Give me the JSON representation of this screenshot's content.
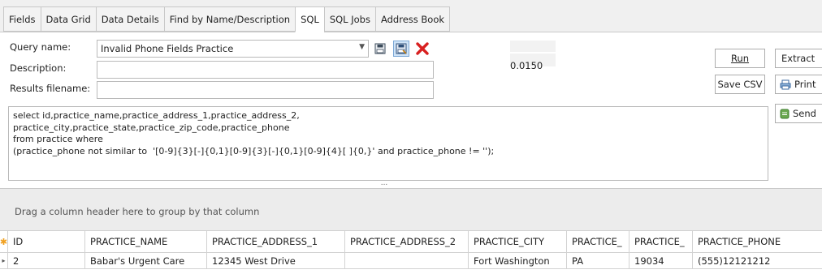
{
  "tabs": [
    "Fields",
    "Data Grid",
    "Data Details",
    "Find by Name/Description",
    "SQL",
    "SQL Jobs",
    "Address Book"
  ],
  "active_tab": "SQL",
  "form": {
    "query_name_label": "Query name:",
    "query_name_value": "Invalid Phone Fields Practice",
    "description_label": "Description:",
    "description_value": "",
    "results_filename_label": "Results filename:",
    "results_filename_value": "",
    "timing": "0.0150"
  },
  "buttons": {
    "run": "Run",
    "extract": "Extract",
    "save_csv": "Save CSV",
    "print": "Print",
    "send": "Send"
  },
  "sql_lines": [
    "select id,practice_name,practice_address_1,practice_address_2,",
    "practice_city,practice_state,practice_zip_code,practice_phone",
    "from practice where",
    "(practice_phone not similar to  '[0-9]{3}[-]{0,1}[0-9]{3}[-]{0,1}[0-9]{4}[ ]{0,}' and practice_phone != '');"
  ],
  "splitter_label": "...",
  "group_hint": "Drag a column header here to group by that column",
  "grid": {
    "columns": [
      "ID",
      "PRACTICE_NAME",
      "PRACTICE_ADDRESS_1",
      "PRACTICE_ADDRESS_2",
      "PRACTICE_CITY",
      "PRACTICE_",
      "PRACTICE_",
      "PRACTICE_PHONE"
    ],
    "rows": [
      [
        "2",
        "Babar's Urgent Care",
        "12345 West Drive",
        "",
        "Fort Washington",
        "PA",
        "19034",
        "(555)12121212"
      ]
    ]
  },
  "colors": {
    "active_tab_bg": "#ffffff",
    "pressed_button": "#cfe3f7",
    "delete_icon": "#d82020",
    "new_row_star": "#f0a020"
  }
}
